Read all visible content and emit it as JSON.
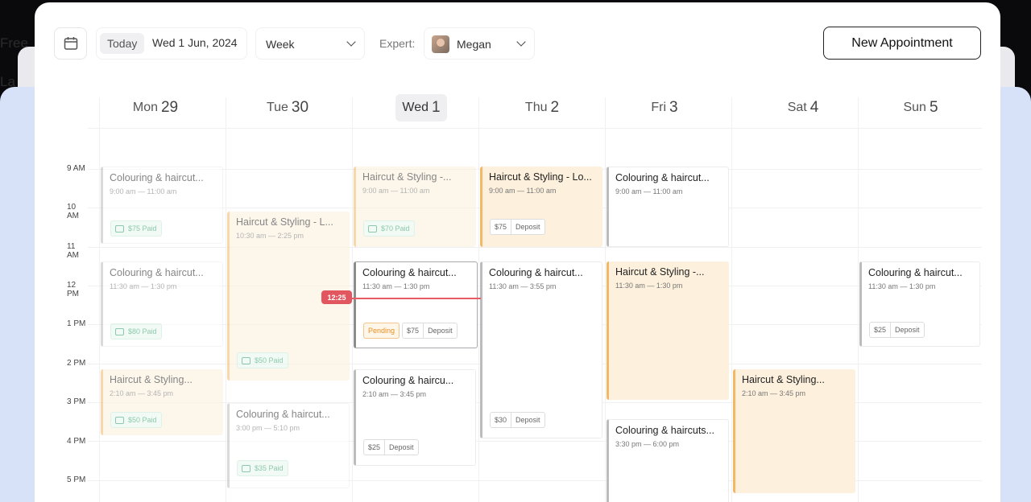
{
  "background": {
    "text1": "Free",
    "text2": "La"
  },
  "toolbar": {
    "today_label": "Today",
    "date_label": "Wed 1 Jun, 2024",
    "view_value": "Week",
    "expert_label": "Expert:",
    "expert_name": "Megan",
    "new_button_label": "New Appointment"
  },
  "days": [
    {
      "name": "Mon",
      "num": "29"
    },
    {
      "name": "Tue",
      "num": "30"
    },
    {
      "name": "Wed",
      "num": "1"
    },
    {
      "name": "Thu",
      "num": "2"
    },
    {
      "name": "Fri",
      "num": "3"
    },
    {
      "name": "Sat",
      "num": "4"
    },
    {
      "name": "Sun",
      "num": "5"
    }
  ],
  "hours": [
    "9 AM",
    "10 AM",
    "11 AM",
    "12 PM",
    "1 PM",
    "2 PM",
    "3 PM",
    "4 PM",
    "5 PM"
  ],
  "now_time": "12:25",
  "events": {
    "mon1": {
      "title": "Colouring & haircut...",
      "time": "9:00 am — 11:00 am",
      "chip": "$75 Paid"
    },
    "mon2": {
      "title": "Colouring & haircut...",
      "time": "11:30 am — 1:30 pm",
      "chip": "$80 Paid"
    },
    "mon3": {
      "title": "Haircut & Styling...",
      "time": "2:10 am — 3:45 pm",
      "chip": "$50 Paid"
    },
    "tue1": {
      "title": "Haircut & Styling - L...",
      "time": "10:30 am — 2:25 pm",
      "chip": "$50 Paid"
    },
    "tue2": {
      "title": "Colouring & haircut...",
      "time": "3:00 pm — 5:10 pm",
      "chip": "$35 Paid"
    },
    "wed1": {
      "title": "Haircut & Styling -...",
      "time": "9:00 am — 11:00 am",
      "chip": "$70 Paid"
    },
    "wed2": {
      "title": "Colouring & haircut...",
      "time": "11:30 am — 1:30 pm",
      "status": "Pending",
      "amount": "$75",
      "type": "Deposit"
    },
    "wed3": {
      "title": "Colouring & haircu...",
      "time": "2:10 am — 3:45 pm",
      "amount": "$25",
      "type": "Deposit"
    },
    "thu1": {
      "title": "Haircut & Styling - Lo...",
      "time": "9:00 am — 11:00 am",
      "amount": "$75",
      "type": "Deposit"
    },
    "thu2": {
      "title": "Colouring & haircut...",
      "time": "11:30 am — 3:55 pm",
      "amount": "$30",
      "type": "Deposit"
    },
    "fri1": {
      "title": "Colouring & haircut...",
      "time": "9:00 am — 11:00 am"
    },
    "fri2": {
      "title": "Haircut & Styling -...",
      "time": "11:30 am — 1:30 pm"
    },
    "fri3": {
      "title": "Colouring & haircuts...",
      "time": "3:30 pm — 6:00 pm"
    },
    "sat1": {
      "title": "Haircut & Styling...",
      "time": "2:10 am — 3:45 pm"
    },
    "sun1": {
      "title": "Colouring & haircut...",
      "time": "11:30 am — 1:30 pm",
      "amount": "$25",
      "type": "Deposit"
    }
  },
  "colors": {
    "accent_orange": "#f3b866",
    "paid_green": "#2f9e69",
    "pending_orange": "#e98f23",
    "now_red": "#e25660"
  }
}
